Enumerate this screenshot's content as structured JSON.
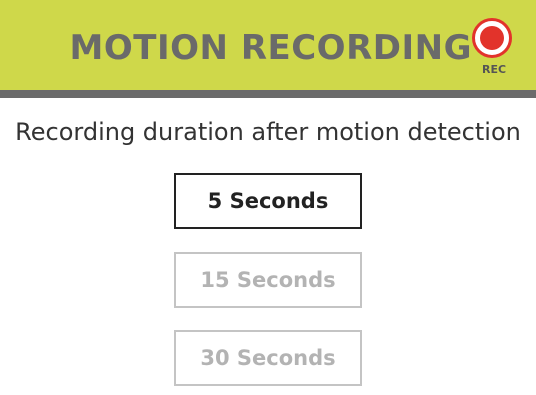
{
  "header": {
    "title": "MOTION RECORDING",
    "rec_label": "REC",
    "rec_icon": "record-icon",
    "accent_color": "#cfd84a",
    "rec_color": "#e2332b"
  },
  "subtitle": "Recording duration after motion detection",
  "options": [
    {
      "label": "5 Seconds",
      "selected": true
    },
    {
      "label": "15 Seconds",
      "selected": false
    },
    {
      "label": "30 Seconds",
      "selected": false
    }
  ]
}
